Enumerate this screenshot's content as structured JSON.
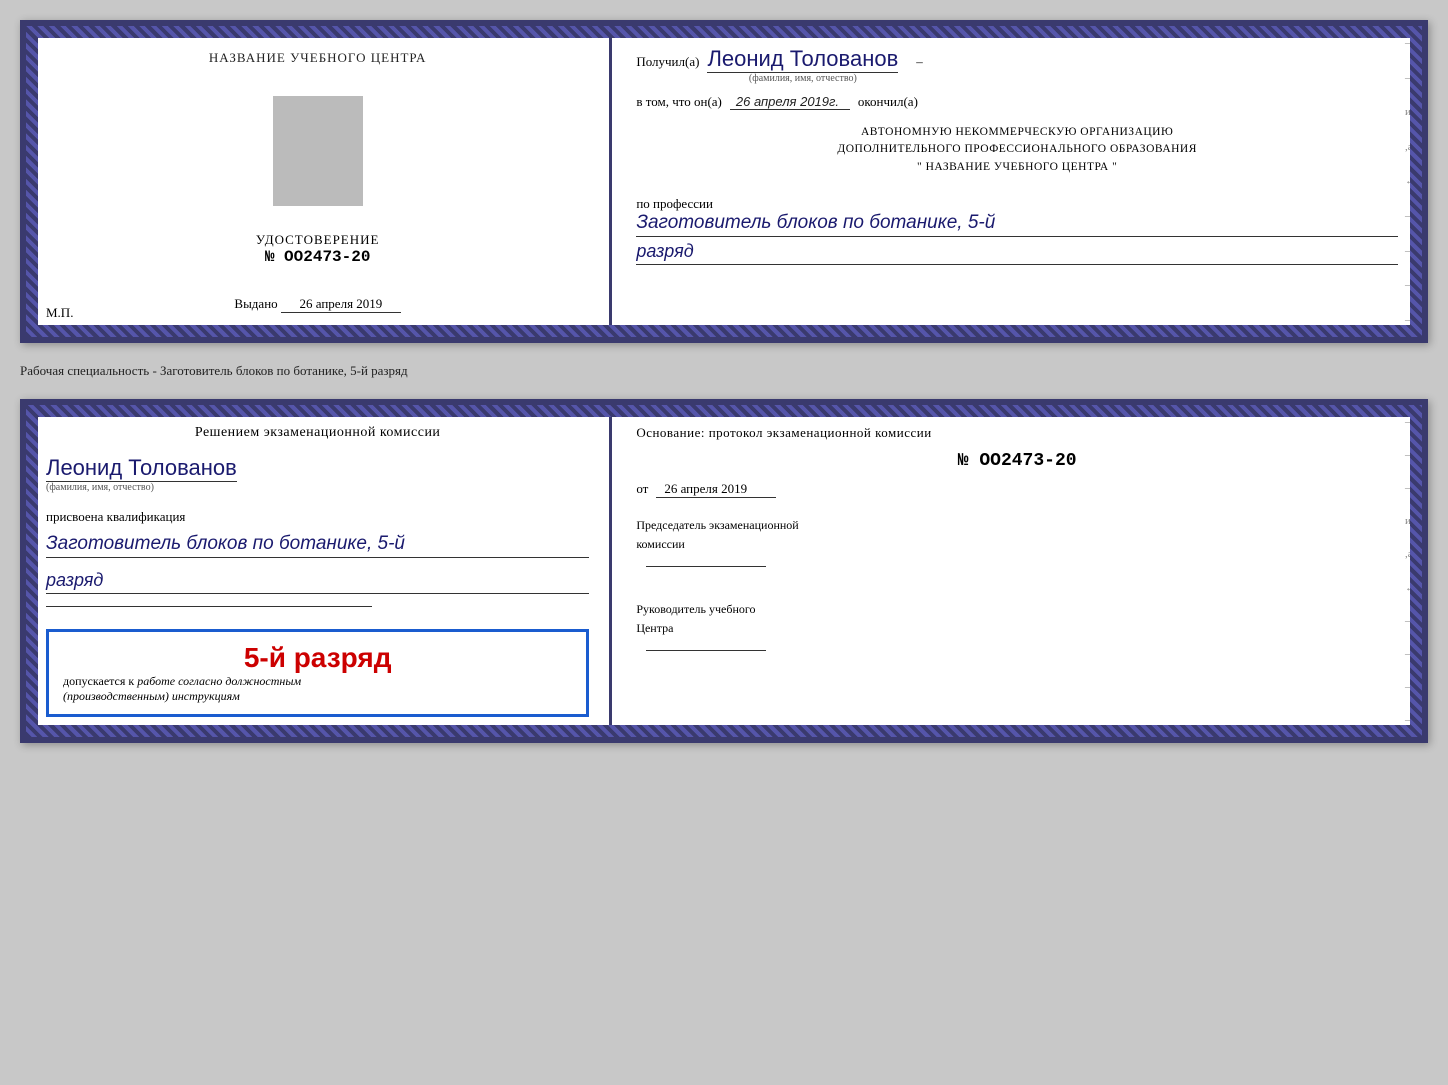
{
  "top_document": {
    "left": {
      "title": "НАЗВАНИЕ УЧЕБНОГО ЦЕНТРА",
      "cert_label": "УДОСТОВЕРЕНИЕ",
      "cert_number": "№ OO2473-20",
      "issued_label": "Выдано",
      "issued_date": "26 апреля 2019",
      "mp_label": "М.П."
    },
    "right": {
      "received_prefix": "Получил(а)",
      "recipient_name": "Леонид Толованов",
      "name_subtext": "(фамилия, имя, отчество)",
      "dash": "–",
      "confirm_text": "в том, что он(а)",
      "confirm_date": "26 апреля 2019г.",
      "confirm_suffix": "окончил(а)",
      "org_line1": "АВТОНОМНУЮ НЕКОММЕРЧЕСКУЮ ОРГАНИЗАЦИЮ",
      "org_line2": "ДОПОЛНИТЕЛЬНОГО ПРОФЕССИОНАЛЬНОГО ОБРАЗОВАНИЯ",
      "org_line3": "\"  НАЗВАНИЕ УЧЕБНОГО ЦЕНТРА  \"",
      "profession_label": "по профессии",
      "profession_name": "Заготовитель блоков по ботанике, 5-й",
      "rank_text": "разряд",
      "dashes": [
        "-",
        "-",
        "–",
        "-",
        "а",
        "←",
        "-",
        "-",
        "-",
        "-"
      ]
    }
  },
  "specialty_label": "Рабочая специальность - Заготовитель блоков по ботанике, 5-й разряд",
  "bottom_document": {
    "left": {
      "decision_text": "Решением экзаменационной комиссии",
      "person_name": "Леонид Толованов",
      "name_subtext": "(фамилия, имя, отчество)",
      "qualification_assigned": "присвоена квалификация",
      "qualification_name": "Заготовитель блоков по ботанике, 5-й",
      "rank_text": "разряд",
      "stamp_rank": "5-й разряд",
      "allowed_text": "допускается к",
      "allowed_italic": "работе согласно должностным",
      "instructions_italic": "(производственным) инструкциям"
    },
    "right": {
      "basis_text": "Основание: протокол экзаменационной комиссии",
      "protocol_number": "№  OO2473-20",
      "from_label": "от",
      "from_date": "26 апреля 2019",
      "chairman_label": "Председатель экзаменационной",
      "chairman_label2": "комиссии",
      "director_label": "Руководитель учебного",
      "director_label2": "Центра",
      "dashes": [
        "-",
        "-",
        "–",
        "и",
        "а",
        "←",
        "-",
        "-",
        "-",
        "-"
      ]
    }
  }
}
